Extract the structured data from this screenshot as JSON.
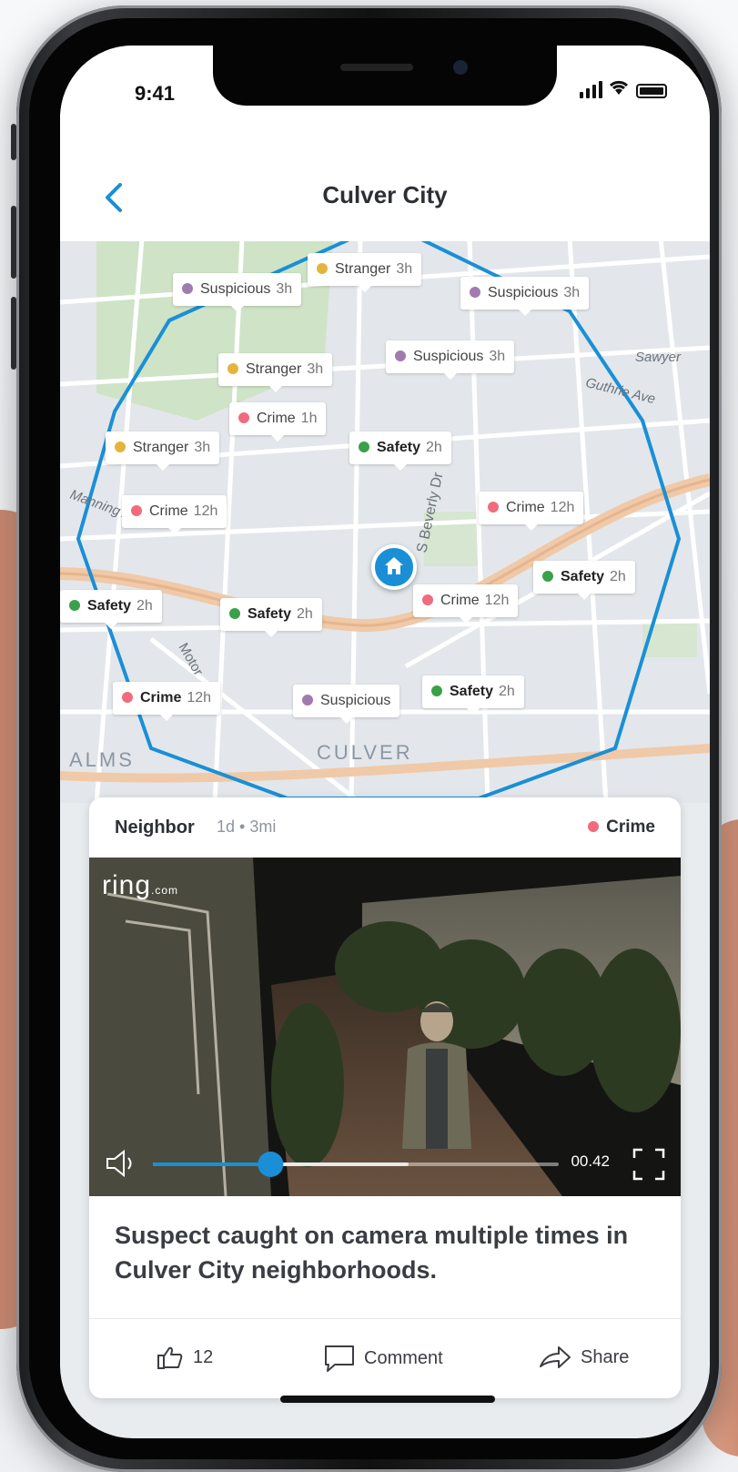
{
  "status_bar": {
    "time": "9:41"
  },
  "header": {
    "title": "Culver City"
  },
  "map": {
    "area_labels": [
      "ALMS",
      "CULVER"
    ],
    "pins": [
      {
        "category": "Stranger",
        "age": "3h",
        "color": "#e6b33c",
        "bold": false
      },
      {
        "category": "Suspicious",
        "age": "3h",
        "color": "#a07bb0",
        "bold": false
      },
      {
        "category": "Suspicious",
        "age": "3h",
        "color": "#a07bb0",
        "bold": false
      },
      {
        "category": "Stranger",
        "age": "3h",
        "color": "#e6b33c",
        "bold": false
      },
      {
        "category": "Suspicious",
        "age": "3h",
        "color": "#a07bb0",
        "bold": false
      },
      {
        "category": "Crime",
        "age": "1h",
        "color": "#f06c7c",
        "bold": false
      },
      {
        "category": "Stranger",
        "age": "3h",
        "color": "#e6b33c",
        "bold": false
      },
      {
        "category": "Safety",
        "age": "2h",
        "color": "#3aa04a",
        "bold": true
      },
      {
        "category": "Crime",
        "age": "12h",
        "color": "#f06c7c",
        "bold": false
      },
      {
        "category": "Crime",
        "age": "12h",
        "color": "#f06c7c",
        "bold": false
      },
      {
        "category": "Safety",
        "age": "2h",
        "color": "#3aa04a",
        "bold": true
      },
      {
        "category": "Safety",
        "age": "2h",
        "color": "#3aa04a",
        "bold": true
      },
      {
        "category": "Safety",
        "age": "2h",
        "color": "#3aa04a",
        "bold": true
      },
      {
        "category": "Crime",
        "age": "12h",
        "color": "#f06c7c",
        "bold": false
      },
      {
        "category": "Crime",
        "age": "12h",
        "color": "#f06c7c",
        "bold": true
      },
      {
        "category": "Suspicious",
        "age": "",
        "color": "#a07bb0",
        "bold": false
      },
      {
        "category": "Safety",
        "age": "2h",
        "color": "#3aa04a",
        "bold": true
      }
    ]
  },
  "post": {
    "author": "Neighbor",
    "meta": "1d • 3mi",
    "category": "Crime",
    "video": {
      "watermark": "ring",
      "watermark_suffix": ".com",
      "elapsed": "00.42",
      "progress": 0.29,
      "buffered": 0.63
    },
    "caption": "Suspect caught on camera multiple times in Culver City neighborhoods.",
    "actions": {
      "likes": "12",
      "comment": "Comment",
      "share": "Share"
    }
  },
  "colors": {
    "accent": "#1a8fd6",
    "crime": "#f06c7c",
    "safety": "#3aa04a",
    "stranger": "#e6b33c",
    "suspicious": "#a07bb0"
  }
}
